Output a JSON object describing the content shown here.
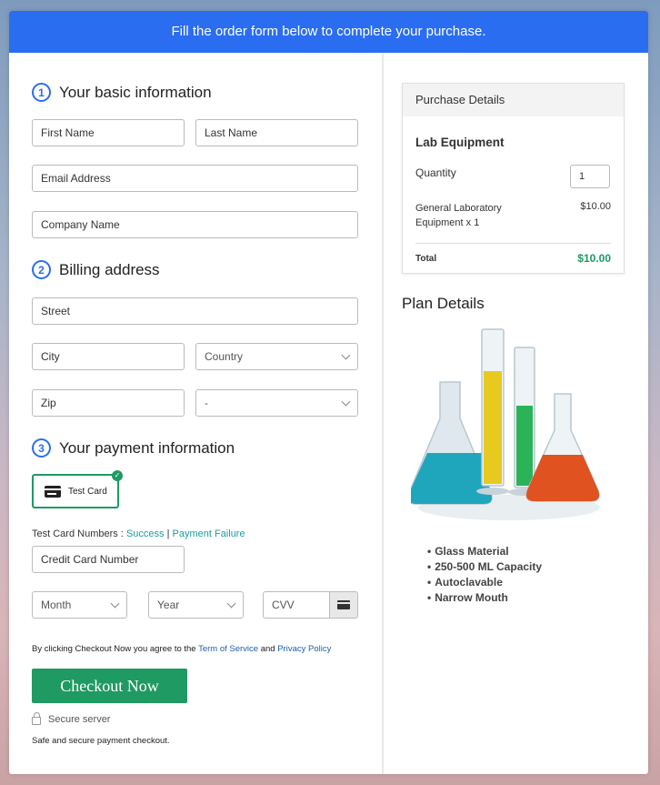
{
  "banner": {
    "text": "Fill the order form below to complete your purchase."
  },
  "basic": {
    "step": "1",
    "title": "Your basic information",
    "first_name": "First Name",
    "last_name": "Last Name",
    "email": "Email Address",
    "company": "Company Name"
  },
  "billing": {
    "step": "2",
    "title": "Billing address",
    "street": "Street",
    "city": "City",
    "country": "Country",
    "zip": "Zip",
    "state": "-"
  },
  "payment": {
    "step": "3",
    "title": "Your payment information",
    "card_option": "Test Card",
    "test_nums_label": "Test Card Numbers :",
    "success_link": "Success",
    "separator": "|",
    "failure_link": "Payment Failure",
    "card_number": "Credit Card Number",
    "month": "Month",
    "year": "Year",
    "cvv": "CVV"
  },
  "agreement": {
    "prefix": "By clicking Checkout Now you agree to the",
    "terms": "Term of Service",
    "and": "and",
    "privacy": "Privacy Policy"
  },
  "checkout": {
    "label": "Checkout Now"
  },
  "secure": {
    "label": "Secure server",
    "note": "Safe and secure payment checkout."
  },
  "purchase": {
    "header": "Purchase Details",
    "product": "Lab Equipment",
    "quantity_label": "Quantity",
    "quantity": "1",
    "item_desc": "General Laboratory Equipment x 1",
    "item_price": "$10.00",
    "total_label": "Total",
    "total_value": "$10.00"
  },
  "plan": {
    "title": "Plan Details",
    "features": [
      "Glass Material",
      "250-500 ML Capacity",
      "Autoclavable",
      "Narrow Mouth"
    ]
  },
  "colors": {
    "accent": "#2a6df1",
    "checkout": "#1f9a62",
    "link": "#1a9ba3"
  }
}
